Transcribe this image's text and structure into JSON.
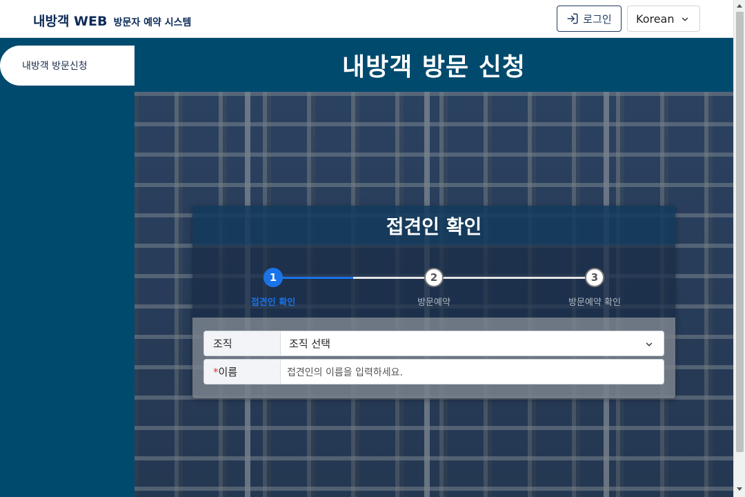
{
  "header": {
    "brand_main": "내방객 WEB",
    "brand_sub": "방문자 예약 시스템",
    "login_label": "로그인",
    "language": "Korean"
  },
  "sidebar": {
    "items": [
      {
        "label": "내방객 방문신청",
        "active": true
      }
    ]
  },
  "page": {
    "title": "내방객 방문 신청"
  },
  "card": {
    "title": "접견인 확인",
    "steps": [
      {
        "number": "1",
        "label": "접견인 확인",
        "state": "active"
      },
      {
        "number": "2",
        "label": "방문예약",
        "state": "idle"
      },
      {
        "number": "3",
        "label": "방문예약 확인",
        "state": "idle"
      }
    ],
    "form": {
      "org_label": "조직",
      "org_value": "조직 선택",
      "name_required_mark": "*",
      "name_label": "이름",
      "name_placeholder": "접견인의 이름을 입력하세요."
    }
  },
  "colors": {
    "primary": "#004a6e",
    "accent": "#1a73e8",
    "brand_text": "#0b2a57",
    "required": "#e03131"
  },
  "icons": {
    "login": "login-icon",
    "dropdown": "chevron-down-icon"
  }
}
